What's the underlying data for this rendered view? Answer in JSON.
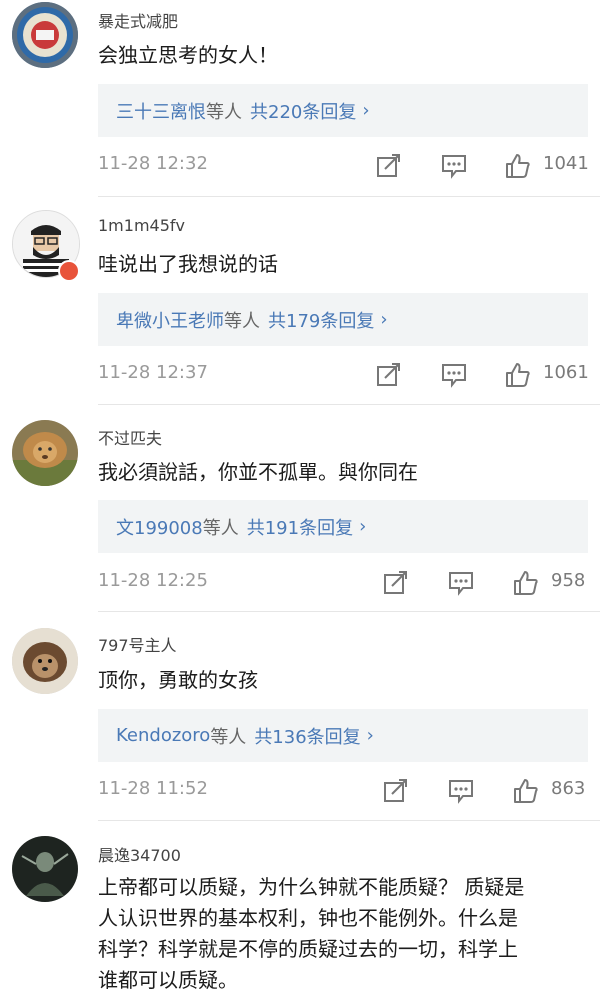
{
  "comments": [
    {
      "username": "暴走式减肥",
      "text": "会独立思考的女人！",
      "reply_user": "三十三离恨",
      "reply_suffix": "等人",
      "reply_count": "共220条回复",
      "time": "11-28 12:32",
      "likes": "1041",
      "avatar_icon": "badge-avatar"
    },
    {
      "username": "1m1m45fv",
      "text": "哇说出了我想说的话",
      "reply_user": "卑微小王老师",
      "reply_suffix": "等人",
      "reply_count": "共179条回复",
      "time": "11-28 12:37",
      "likes": "1061",
      "avatar_icon": "bearded-man-avatar"
    },
    {
      "username": "不过匹夫",
      "text": "我必須說話，你並不孤單。與你同在",
      "reply_user": "文199008",
      "reply_suffix": "等人",
      "reply_count": "共191条回复",
      "time": "11-28 12:25",
      "likes": "958",
      "avatar_icon": "lion-avatar"
    },
    {
      "username": "797号主人",
      "text": "顶你，勇敢的女孩",
      "reply_user": "Kendozoro",
      "reply_suffix": "等人",
      "reply_count": "共136条回复",
      "time": "11-28 11:52",
      "likes": "863",
      "avatar_icon": "dog-avatar"
    },
    {
      "username": "晨逸34700",
      "text_lines": [
        "上帝都可以质疑，为什么钟就不能质疑？ 质疑是",
        "人认识世界的基本权利，钟也不能例外。什么是",
        "科学？科学就是不停的质疑过去的一切，科学上",
        "谁都可以质疑。"
      ],
      "avatar_icon": "dark-figure-avatar"
    }
  ],
  "icons": {
    "share": "share-icon",
    "comment": "comment-icon",
    "like": "thumbs-up-icon",
    "reply_chevron": "›"
  },
  "colors": {
    "link": "#4a79b6",
    "reply_bg": "#f2f4f5",
    "meta": "#9a9a9a"
  }
}
